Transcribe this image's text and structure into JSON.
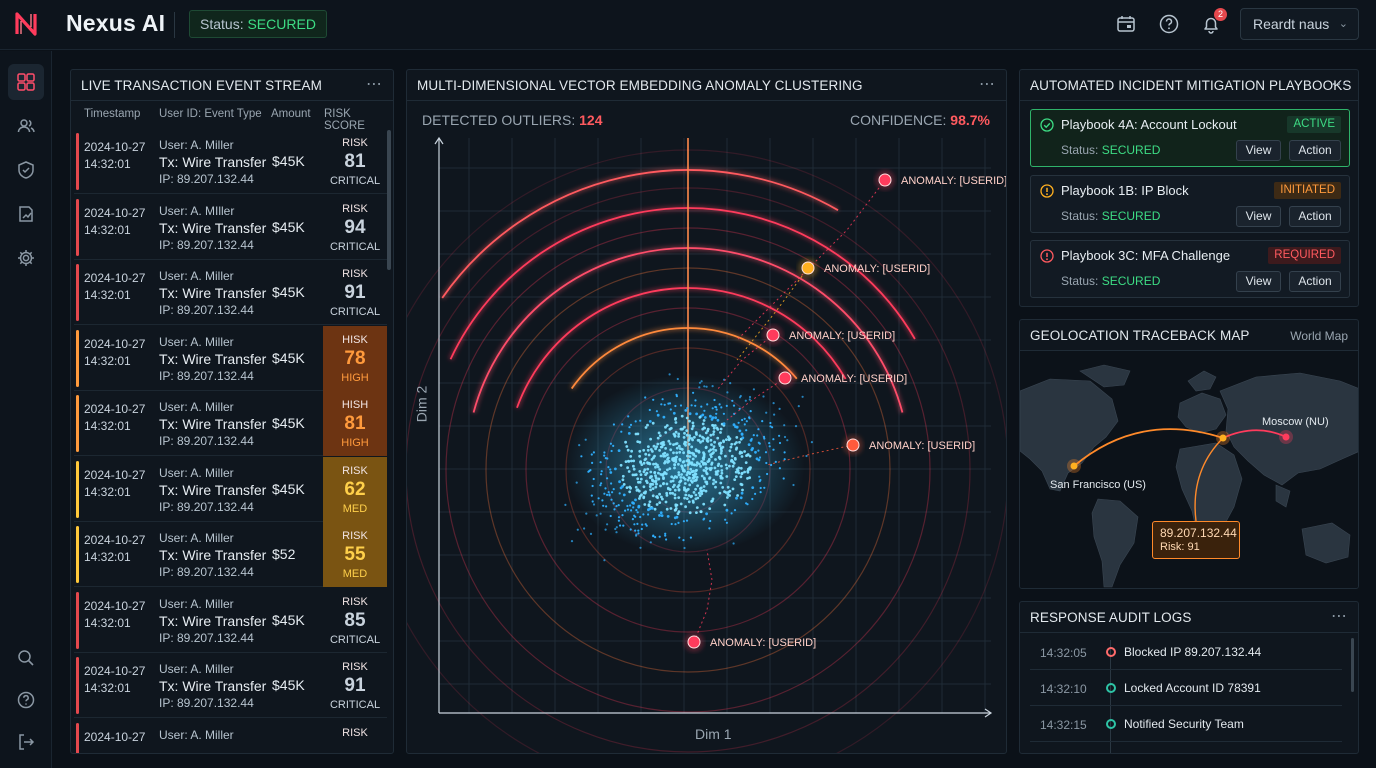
{
  "header": {
    "app_name": "Nexus AI",
    "status_label": "Status: ",
    "status_value": "SECURED",
    "notification_count": "2",
    "user_name": "Reardt naus",
    "icons": [
      "calendar-wallet-icon",
      "help-icon",
      "bell-icon",
      "chevron-down-icon"
    ]
  },
  "sidebar": {
    "items": [
      {
        "name": "dashboard-icon",
        "active": true
      },
      {
        "name": "users-icon",
        "active": false
      },
      {
        "name": "shield-icon",
        "active": false
      },
      {
        "name": "reports-icon",
        "active": false
      },
      {
        "name": "settings-icon",
        "active": false
      },
      {
        "name": "search-icon",
        "active": false
      },
      {
        "name": "help-icon",
        "active": false
      },
      {
        "name": "logout-icon",
        "active": false
      }
    ]
  },
  "stream": {
    "title": "LIVE TRANSACTION EVENT STREAM",
    "columns": [
      "Timestamp",
      "User ID: Event Type",
      "Amount",
      "RISK SCORE"
    ],
    "rows": [
      {
        "date": "2024-10-27",
        "time": "14:32:01",
        "user": "User: A. Miller",
        "type": "Tx: Wire Transfer",
        "ip": "IP: 89.207.132.44",
        "amount": "$45K",
        "risk_label": "RISK",
        "score": "81",
        "level": "CRITICAL",
        "severity": "critical"
      },
      {
        "date": "2024-10-27",
        "time": "14:32:01",
        "user": "User: A. MIller",
        "type": "Tx: Wire Transfer",
        "ip": "IP: 89.207.132.44",
        "amount": "$45K",
        "risk_label": "RISK",
        "score": "94",
        "level": "CRITICAL",
        "severity": "critical"
      },
      {
        "date": "2024-10-27",
        "time": "14:32:01",
        "user": "User: A. Miller",
        "type": "Tx: Wire Transfer",
        "ip": "IP: 89.207.132.44",
        "amount": "$45K",
        "risk_label": "RISK",
        "score": "91",
        "level": "CRITICAL",
        "severity": "critical"
      },
      {
        "date": "2024-10-27",
        "time": "14:32:01",
        "user": "User: A. Miller",
        "type": "Tx: Wire Transfer",
        "ip": "IP: 89.207.132.44",
        "amount": "$45K",
        "risk_label": "HISK",
        "score": "78",
        "level": "HIGH",
        "severity": "high"
      },
      {
        "date": "2024-10-27",
        "time": "14:32:01",
        "user": "User: A. Miller",
        "type": "Tx: Wire Transfer",
        "ip": "IP: 89.207.132.44",
        "amount": "$45K",
        "risk_label": "HISH",
        "score": "81",
        "level": "HIGH",
        "severity": "high"
      },
      {
        "date": "2024-10-27",
        "time": "14:32:01",
        "user": "User: A. Miller",
        "type": "Tx: Wire Transfer",
        "ip": "IP: 89.207.132.44",
        "amount": "$45K",
        "risk_label": "RISK",
        "score": "62",
        "level": "MED",
        "severity": "med"
      },
      {
        "date": "2024-10-27",
        "time": "14:32:01",
        "user": "User: A. Miller",
        "type": "Tx: Wire Transfer",
        "ip": "IP: 89.207.132.44",
        "amount": "$52",
        "risk_label": "RISK",
        "score": "55",
        "level": "MED",
        "severity": "med"
      },
      {
        "date": "2024-10-27",
        "time": "14:32:01",
        "user": "User: A. Miller",
        "type": "Tx: Wire Transfer",
        "ip": "IP: 89.207.132.44",
        "amount": "$45K",
        "risk_label": "RISK",
        "score": "85",
        "level": "CRITICAL",
        "severity": "critical"
      },
      {
        "date": "2024-10-27",
        "time": "14:32:01",
        "user": "User: A. Miller",
        "type": "Tx: Wire Transfer",
        "ip": "IP: 89.207.132.44",
        "amount": "$45K",
        "risk_label": "RISK",
        "score": "91",
        "level": "CRITICAL",
        "severity": "critical"
      },
      {
        "date": "2024-10-27",
        "time": "",
        "user": "User: A. Miller",
        "type": "",
        "ip": "",
        "amount": "",
        "risk_label": "RISK",
        "score": "",
        "level": "",
        "severity": "critical"
      }
    ]
  },
  "vector": {
    "title": "MULTI-DIMENSIONAL VECTOR EMBEDDING ANOMALY CLUSTERING",
    "outliers_label": "DETECTED OUTLIERS: ",
    "outliers_value": "124",
    "confidence_label": "CONFIDENCE: ",
    "confidence_value": "98.7%",
    "x_label": "Dim 1",
    "y_label": "Dim 2",
    "anomalies": [
      {
        "label": "ANOMALY: [USERID]",
        "color": "#ff3b5c"
      },
      {
        "label": "ANOMALY: [USERID]",
        "color": "#ffb020"
      },
      {
        "label": "ANOMALY: [USERID]",
        "color": "#ff3b5c"
      },
      {
        "label": "ANOMALY: [USERID]",
        "color": "#ff3b5c"
      },
      {
        "label": "ANOMALY: [USERID]",
        "color": "#ff5a3c"
      },
      {
        "label": "ANOMALY: [USERID]",
        "color": "#ff3b5c"
      }
    ]
  },
  "playbooks": {
    "title": "AUTOMATED INCIDENT MITIGATION PLAYBOOKS",
    "items": [
      {
        "name": "Playbook 4A: Account Lockout",
        "status_label": "Status: ",
        "status_value": "SECURED",
        "badge": "ACTIVE",
        "kind": "active",
        "icon": "check-circle-icon"
      },
      {
        "name": "Playbook 1B: IP Block",
        "status_label": "Status: ",
        "status_value": "SECURED",
        "badge": "INITIATED",
        "kind": "initiated",
        "icon": "warning-circle-icon"
      },
      {
        "name": "Playbook 3C: MFA Challenge",
        "status_label": "Status: ",
        "status_value": "SECURED",
        "badge": "REQUIRED",
        "kind": "required",
        "icon": "alert-circle-icon"
      }
    ],
    "view_label": "View",
    "action_label": "Action"
  },
  "geo": {
    "title": "GEOLOCATION TRACEBACK MAP",
    "subtitle": "World Map",
    "origin_label": "San Francisco (US)",
    "target_label": "Moscow (NU)",
    "tip_ip": "89.207.132.44",
    "tip_risk": "Risk: 91"
  },
  "audit": {
    "title": "RESPONSE AUDIT LOGS",
    "rows": [
      {
        "time": "14:32:05",
        "text": "Blocked IP 89.207.132.44",
        "dot_color": "#ff6b6b"
      },
      {
        "time": "14:32:10",
        "text": "Locked Account ID 78391",
        "dot_color": "#2ec4a6"
      },
      {
        "time": "14:32:15",
        "text": "Notified Security Team",
        "dot_color": "#2ec4a6"
      }
    ]
  }
}
